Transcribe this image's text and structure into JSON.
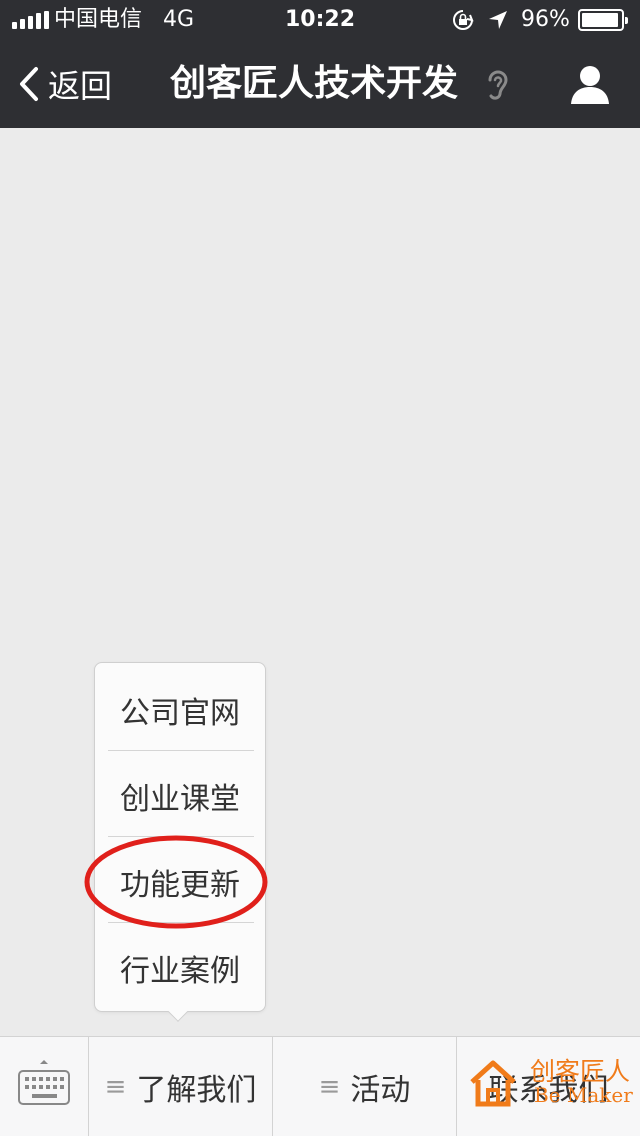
{
  "status_bar": {
    "carrier": "中国电信",
    "network": "4G",
    "time": "10:22",
    "battery_percent": "96%",
    "battery_level": 0.96
  },
  "nav": {
    "back_label": "返回",
    "title": "创客匠人技术开发",
    "icons": [
      "chevron-left-icon",
      "ear-icon",
      "person-icon"
    ]
  },
  "popup_menu": {
    "items": [
      {
        "label": "公司官网"
      },
      {
        "label": "创业课堂"
      },
      {
        "label": "功能更新",
        "highlighted": true
      },
      {
        "label": "行业案例"
      }
    ],
    "highlight_color": "#e0201b"
  },
  "bottom_menu": {
    "keyboard_icon": "keyboard-icon",
    "tabs": [
      {
        "label": "了解我们"
      },
      {
        "label": "活动"
      },
      {
        "label": "联系我们"
      }
    ]
  },
  "watermark": {
    "text_cn": "创客匠人",
    "text_en": "Be Maker",
    "color": "#f07b1a"
  },
  "colors": {
    "header_bg": "#2e2f33",
    "chat_bg": "#ebebeb",
    "menu_bg": "#f7f7f8"
  }
}
